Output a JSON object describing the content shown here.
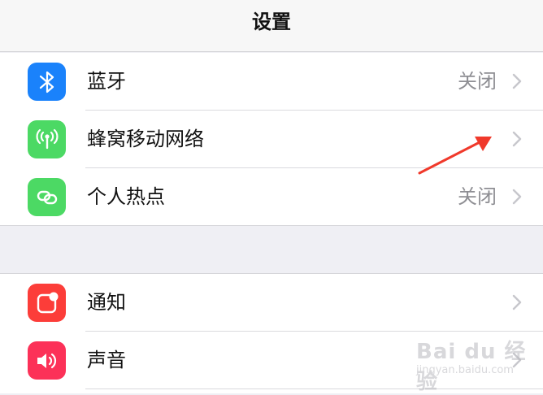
{
  "nav": {
    "title": "设置"
  },
  "groups": [
    {
      "cells": [
        {
          "label": "蓝牙",
          "value": "关闭",
          "icon": "bluetooth-icon",
          "icon_color": "#1a82fb"
        },
        {
          "label": "蜂窝移动网络",
          "value": "",
          "icon": "cellular-antenna-icon",
          "icon_color": "#4cd964"
        },
        {
          "label": "个人热点",
          "value": "关闭",
          "icon": "personal-hotspot-icon",
          "icon_color": "#4cd964"
        }
      ]
    },
    {
      "cells": [
        {
          "label": "通知",
          "value": "",
          "icon": "notifications-icon",
          "icon_color": "#fc3d39"
        },
        {
          "label": "声音",
          "value": "",
          "icon": "sound-speaker-icon",
          "icon_color": "#fc3158"
        }
      ]
    }
  ],
  "annotation": {
    "arrow_color": "#f0392b"
  },
  "watermark": {
    "logo": "Bai du 经验",
    "url": "jingyan.baidu.com"
  },
  "colors": {
    "background": "#efeff4",
    "chevron": "#c7c7cc",
    "value_text": "#8e8e93"
  }
}
